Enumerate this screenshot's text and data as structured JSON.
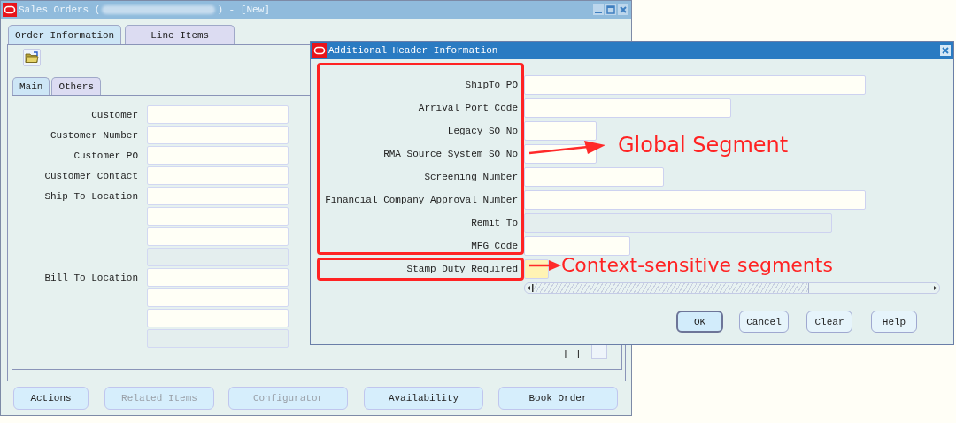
{
  "main_window": {
    "title_start": "Sales Orders (",
    "title_end": ") - [New]",
    "tabs": [
      {
        "label": "Order Information",
        "selected": true
      },
      {
        "label": "Line Items",
        "selected": false
      }
    ],
    "subtabs": [
      {
        "label": "Main",
        "selected": true
      },
      {
        "label": "Others",
        "selected": false
      }
    ],
    "fields": [
      {
        "label": "Customer",
        "disabled": false
      },
      {
        "label": "Customer Number",
        "disabled": false
      },
      {
        "label": "Customer PO",
        "disabled": false
      },
      {
        "label": "Customer Contact",
        "disabled": false
      },
      {
        "label": "Ship To Location",
        "disabled": false
      },
      {
        "disabled": false
      },
      {
        "disabled": false
      },
      {
        "disabled": true
      },
      {
        "label": "Bill To Location",
        "disabled": false
      },
      {
        "disabled": false
      },
      {
        "disabled": false
      },
      {
        "disabled": true
      }
    ],
    "flag_text": "[ ]",
    "flag_checked": false,
    "buttons": [
      {
        "label": "Actions",
        "disabled": false
      },
      {
        "label": "Related Items",
        "disabled": true
      },
      {
        "label": "Configurator",
        "disabled": true
      },
      {
        "label": "Availability",
        "disabled": false
      },
      {
        "label": "Book Order",
        "disabled": false
      }
    ]
  },
  "dialog": {
    "title": "Additional Header Information",
    "fields": [
      {
        "label": "ShipTo PO",
        "disabled": false,
        "required": false
      },
      {
        "label": "Arrival Port Code",
        "disabled": false,
        "required": false
      },
      {
        "label": "Legacy SO No",
        "disabled": false,
        "required": false
      },
      {
        "label": "RMA Source System SO No",
        "disabled": false,
        "required": false
      },
      {
        "label": "Screening Number",
        "disabled": false,
        "required": false
      },
      {
        "label": "Financial Company Approval Number",
        "disabled": false,
        "required": false
      },
      {
        "label": "Remit To",
        "disabled": true,
        "required": false
      },
      {
        "label": "MFG Code",
        "disabled": false,
        "required": false
      },
      {
        "label": "Stamp Duty Required",
        "disabled": false,
        "required": true
      }
    ],
    "buttons": [
      {
        "label": "OK",
        "default": true
      },
      {
        "label": "Cancel",
        "default": false
      },
      {
        "label": "Clear",
        "default": false
      },
      {
        "label": "Help",
        "default": false
      }
    ]
  },
  "annotations": [
    {
      "kind": "global",
      "text": "Global Segment"
    },
    {
      "kind": "context",
      "text": "Context-sensitive segments"
    }
  ]
}
